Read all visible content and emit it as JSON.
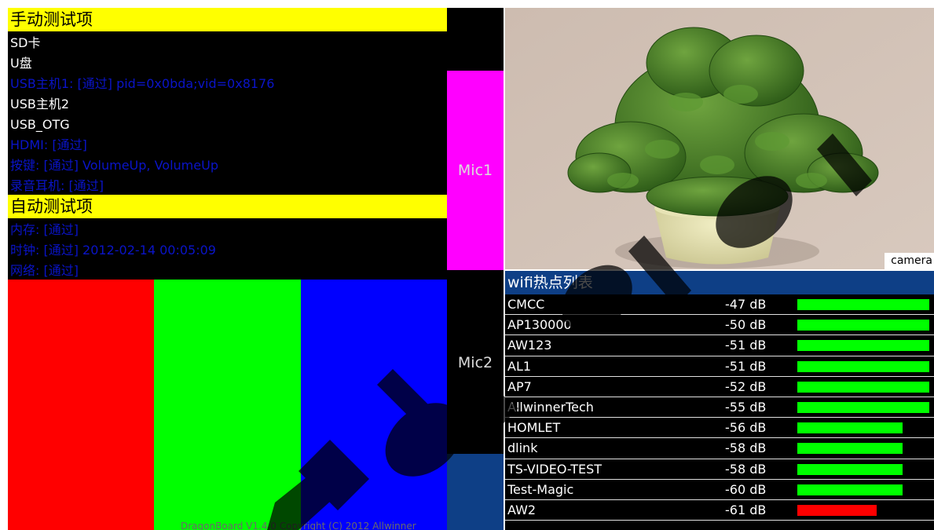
{
  "manual": {
    "title": "手动测试项",
    "items": [
      {
        "text": "SD卡",
        "color": "white"
      },
      {
        "text": "U盘",
        "color": "white"
      },
      {
        "text": "USB主机1: [通过] pid=0x0bda;vid=0x8176",
        "color": "blue"
      },
      {
        "text": "USB主机2",
        "color": "white"
      },
      {
        "text": "USB_OTG",
        "color": "white"
      },
      {
        "text": "HDMI: [通过]",
        "color": "blue"
      },
      {
        "text": "按键: [通过] VolumeUp, VolumeUp",
        "color": "blue"
      },
      {
        "text": "录音耳机: [通过]",
        "color": "blue"
      }
    ]
  },
  "auto": {
    "title": "自动测试项",
    "items": [
      {
        "text": "内存: [通过]",
        "color": "blue"
      },
      {
        "text": "时钟: [通过] 2012-02-14 00:05:09",
        "color": "blue"
      },
      {
        "text": "网络: [通过]",
        "color": "blue"
      }
    ]
  },
  "color_bars": [
    "#ff0000",
    "#00ff00",
    "#0000ff"
  ],
  "footer": "DragonBoard V1.4.0 Copyright (C) 2012 Allwinner",
  "mic": {
    "mic1_label": "Mic1",
    "mic2_label": "Mic2",
    "mic1_color": "#ff00ff",
    "mic2_color": "#000000",
    "mic2_base_color": "#0e3f86"
  },
  "camera": {
    "label": "camera"
  },
  "wifi": {
    "title": "wifi热点列表",
    "hotspots": [
      {
        "name": "CMCC",
        "signal": "-47 dB",
        "strength": 1.0,
        "color": "#00ff00"
      },
      {
        "name": "AP130000",
        "signal": "-50 dB",
        "strength": 1.0,
        "color": "#00ff00"
      },
      {
        "name": "AW123",
        "signal": "-51 dB",
        "strength": 1.0,
        "color": "#00ff00"
      },
      {
        "name": "AL1",
        "signal": "-51 dB",
        "strength": 1.0,
        "color": "#00ff00"
      },
      {
        "name": "AP7",
        "signal": "-52 dB",
        "strength": 1.0,
        "color": "#00ff00"
      },
      {
        "name": "AllwinnerTech",
        "signal": "-55 dB",
        "strength": 1.0,
        "color": "#00ff00"
      },
      {
        "name": "HOMLET",
        "signal": "-56 dB",
        "strength": 0.8,
        "color": "#00ff00"
      },
      {
        "name": "dlink",
        "signal": "-58 dB",
        "strength": 0.8,
        "color": "#00ff00"
      },
      {
        "name": "TS-VIDEO-TEST",
        "signal": "-58 dB",
        "strength": 0.8,
        "color": "#00ff00"
      },
      {
        "name": "Test-Magic",
        "signal": "-60 dB",
        "strength": 0.8,
        "color": "#00ff00"
      },
      {
        "name": "AW2",
        "signal": "-61 dB",
        "strength": 0.6,
        "color": "#ff0000"
      }
    ]
  }
}
